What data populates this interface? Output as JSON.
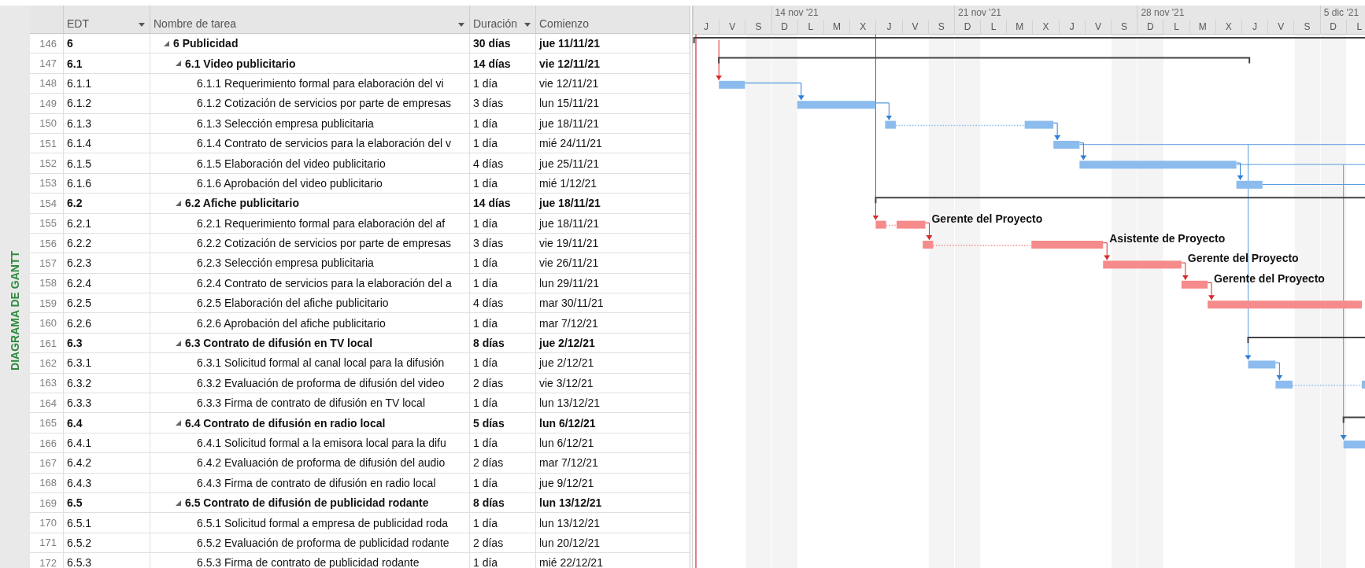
{
  "side_label": "DIAGRAMA DE GANTT",
  "columns": [
    {
      "label": "EDT",
      "filter": true
    },
    {
      "label": "Nombre de tarea",
      "filter": true
    },
    {
      "label": "Duración",
      "filter": true
    },
    {
      "label": "Comienzo",
      "filter": false
    }
  ],
  "timescale": {
    "weeks": [
      {
        "label": "14 nov '21"
      },
      {
        "label": "21 nov '21"
      },
      {
        "label": "28 nov '21"
      },
      {
        "label": "5 dic '21"
      }
    ],
    "days": [
      {
        "label": "J",
        "weekend": false
      },
      {
        "label": "V",
        "weekend": false
      },
      {
        "label": "S",
        "weekend": true
      },
      {
        "label": "D",
        "weekend": true
      },
      {
        "label": "L",
        "weekend": false
      },
      {
        "label": "M",
        "weekend": false
      },
      {
        "label": "X",
        "weekend": false
      },
      {
        "label": "J",
        "weekend": false
      },
      {
        "label": "V",
        "weekend": false
      },
      {
        "label": "S",
        "weekend": true
      },
      {
        "label": "D",
        "weekend": true
      },
      {
        "label": "L",
        "weekend": false
      },
      {
        "label": "M",
        "weekend": false
      },
      {
        "label": "X",
        "weekend": false
      },
      {
        "label": "J",
        "weekend": false
      },
      {
        "label": "V",
        "weekend": false
      },
      {
        "label": "S",
        "weekend": true
      },
      {
        "label": "D",
        "weekend": true
      },
      {
        "label": "L",
        "weekend": false
      },
      {
        "label": "M",
        "weekend": false
      },
      {
        "label": "X",
        "weekend": false
      },
      {
        "label": "J",
        "weekend": false
      },
      {
        "label": "V",
        "weekend": false
      },
      {
        "label": "S",
        "weekend": true
      },
      {
        "label": "D",
        "weekend": true
      },
      {
        "label": "L",
        "weekend": false
      }
    ]
  },
  "rows": [
    {
      "kind": "summary",
      "number": "146",
      "wbs": "6",
      "name": "6 Publicidad",
      "duration": "30 días",
      "start": "jue 11/11/21",
      "expanded": true,
      "children": [
        {
          "kind": "summary",
          "number": "147",
          "wbs": "6.1",
          "name": "6.1 Video publicitario",
          "duration": "14 días",
          "start": "vie 12/11/21",
          "expanded": true,
          "children": [
            {
              "kind": "task",
              "number": "148",
              "wbs": "6.1.1",
              "name": "6.1.1 Requerimiento formal para elaboración del vi",
              "duration": "1 día",
              "start": "vie 12/11/21",
              "critical": false
            },
            {
              "kind": "task",
              "number": "149",
              "wbs": "6.1.2",
              "name": "6.1.2 Cotización de servicios por parte de empresas",
              "duration": "3 días",
              "start": "lun 15/11/21",
              "critical": false
            },
            {
              "kind": "task",
              "number": "150",
              "wbs": "6.1.3",
              "name": "6.1.3 Selección empresa publicitaria",
              "duration": "1 día",
              "start": "jue 18/11/21",
              "critical": false
            },
            {
              "kind": "task",
              "number": "151",
              "wbs": "6.1.4",
              "name": "6.1.4 Contrato de servicios para la elaboración del v",
              "duration": "1 día",
              "start": "mié 24/11/21",
              "critical": false
            },
            {
              "kind": "task",
              "number": "152",
              "wbs": "6.1.5",
              "name": "6.1.5 Elaboración del video publicitario",
              "duration": "4 días",
              "start": "jue 25/11/21",
              "critical": false
            },
            {
              "kind": "task",
              "number": "153",
              "wbs": "6.1.6",
              "name": "6.1.6 Aprobación del video publicitario",
              "duration": "1 día",
              "start": "mié 1/12/21",
              "critical": false
            }
          ]
        },
        {
          "kind": "summary",
          "number": "154",
          "wbs": "6.2",
          "name": "6.2 Afiche publicitario",
          "duration": "14 días",
          "start": "jue 18/11/21",
          "expanded": true,
          "children": [
            {
              "kind": "task",
              "number": "155",
              "wbs": "6.2.1",
              "name": "6.2.1 Requerimiento formal para elaboración del af",
              "duration": "1 día",
              "start": "jue 18/11/21",
              "critical": true,
              "resource": "Gerente del Proyecto"
            },
            {
              "kind": "task",
              "number": "156",
              "wbs": "6.2.2",
              "name": "6.2.2 Cotización de servicios por parte de empresas",
              "duration": "3 días",
              "start": "vie 19/11/21",
              "critical": true,
              "resource": "Asistente de Proyecto"
            },
            {
              "kind": "task",
              "number": "157",
              "wbs": "6.2.3",
              "name": "6.2.3 Selección empresa publicitaria",
              "duration": "1 día",
              "start": "vie 26/11/21",
              "critical": true,
              "resource": "Gerente del Proyecto"
            },
            {
              "kind": "task",
              "number": "158",
              "wbs": "6.2.4",
              "name": "6.2.4 Contrato de servicios para la elaboración del a",
              "duration": "1 día",
              "start": "lun 29/11/21",
              "critical": true,
              "resource": "Gerente del Proyecto"
            },
            {
              "kind": "task",
              "number": "159",
              "wbs": "6.2.5",
              "name": "6.2.5 Elaboración del afiche publicitario",
              "duration": "4 días",
              "start": "mar 30/11/21",
              "critical": true
            },
            {
              "kind": "task",
              "number": "160",
              "wbs": "6.2.6",
              "name": "6.2.6 Aprobación del afiche publicitario",
              "duration": "1 día",
              "start": "mar 7/12/21"
            }
          ]
        },
        {
          "kind": "summary",
          "number": "161",
          "wbs": "6.3",
          "name": "6.3 Contrato de difusión en TV local",
          "duration": "8 días",
          "start": "jue 2/12/21",
          "expanded": true,
          "children": [
            {
              "kind": "task",
              "number": "162",
              "wbs": "6.3.1",
              "name": "6.3.1 Solicitud formal al canal local para la difusión",
              "duration": "1 día",
              "start": "jue 2/12/21",
              "critical": false
            },
            {
              "kind": "task",
              "number": "163",
              "wbs": "6.3.2",
              "name": "6.3.2 Evaluación de proforma de difusión del video",
              "duration": "2 días",
              "start": "vie 3/12/21",
              "critical": false
            },
            {
              "kind": "task",
              "number": "164",
              "wbs": "6.3.3",
              "name": "6.3.3 Firma de contrato de difusión en TV local",
              "duration": "1 día",
              "start": "lun 13/12/21"
            }
          ]
        },
        {
          "kind": "summary",
          "number": "165",
          "wbs": "6.4",
          "name": "6.4 Contrato de difusión en radio local",
          "duration": "5 días",
          "start": "lun 6/12/21",
          "expanded": true,
          "children": [
            {
              "kind": "task",
              "number": "166",
              "wbs": "6.4.1",
              "name": "6.4.1 Solicitud formal a la emisora local para la difu",
              "duration": "1 día",
              "start": "lun 6/12/21",
              "critical": false
            },
            {
              "kind": "task",
              "number": "167",
              "wbs": "6.4.2",
              "name": "6.4.2 Evaluación de proforma de difusión del audio",
              "duration": "2 días",
              "start": "mar 7/12/21"
            },
            {
              "kind": "task",
              "number": "168",
              "wbs": "6.4.3",
              "name": "6.4.3 Firma de contrato de difusión en radio local",
              "duration": "1 día",
              "start": "jue 9/12/21"
            }
          ]
        },
        {
          "kind": "summary",
          "number": "169",
          "wbs": "6.5",
          "name": "6.5 Contrato de difusión de publicidad rodante",
          "duration": "8 días",
          "start": "lun 13/12/21",
          "expanded": true,
          "children": [
            {
              "kind": "task",
              "number": "170",
              "wbs": "6.5.1",
              "name": "6.5.1 Solicitud formal a empresa de publicidad roda",
              "duration": "1 día",
              "start": "lun 13/12/21"
            },
            {
              "kind": "task",
              "number": "171",
              "wbs": "6.5.2",
              "name": "6.5.2 Evaluación de proforma de publicidad rodante",
              "duration": "2 días",
              "start": "lun 20/12/21"
            },
            {
              "kind": "task",
              "number": "172",
              "wbs": "6.5.3",
              "name": "6.5.3 Firma de contrato de publicidad rodante",
              "duration": "1 día",
              "start": "mié 22/12/21"
            }
          ]
        }
      ]
    }
  ]
}
